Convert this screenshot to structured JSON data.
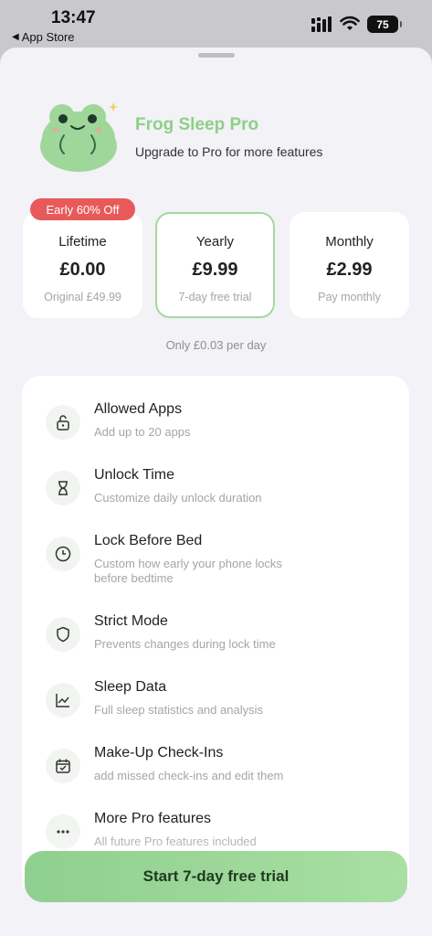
{
  "status_bar": {
    "time": "13:47",
    "back_app": "App Store",
    "battery": "75"
  },
  "header": {
    "title": "Frog Sleep Pro",
    "subtitle": "Upgrade to Pro for more features"
  },
  "plans": {
    "badge": "Early 60% Off",
    "items": [
      {
        "name": "Lifetime",
        "price": "£0.00",
        "note": "Original £49.99",
        "selected": false
      },
      {
        "name": "Yearly",
        "price": "£9.99",
        "note": "7-day free trial",
        "selected": true
      },
      {
        "name": "Monthly",
        "price": "£2.99",
        "note": "Pay monthly",
        "selected": false
      }
    ],
    "per_day": "Only £0.03 per day"
  },
  "features": [
    {
      "title": "Allowed Apps",
      "desc": "Add up to 20 apps",
      "icon": "lock-open-icon"
    },
    {
      "title": "Unlock Time",
      "desc": "Customize daily unlock duration",
      "icon": "hourglass-icon"
    },
    {
      "title": "Lock Before Bed",
      "desc": "Custom how early your phone locks before bedtime",
      "icon": "clock-icon"
    },
    {
      "title": "Strict Mode",
      "desc": "Prevents changes during lock time",
      "icon": "shield-icon"
    },
    {
      "title": "Sleep Data",
      "desc": "Full sleep statistics and analysis",
      "icon": "chart-icon"
    },
    {
      "title": "Make-Up Check-Ins",
      "desc": "add missed check-ins and edit them",
      "icon": "calendar-check-icon"
    },
    {
      "title": "More Pro features",
      "desc": "All future Pro features included",
      "icon": "more-icon"
    }
  ],
  "cta": {
    "label": "Start 7-day free trial"
  },
  "colors": {
    "accent": "#8fcf86",
    "badge": "#e85a5a",
    "cta_start": "#8fcf8f",
    "cta_end": "#a9dfa3"
  }
}
